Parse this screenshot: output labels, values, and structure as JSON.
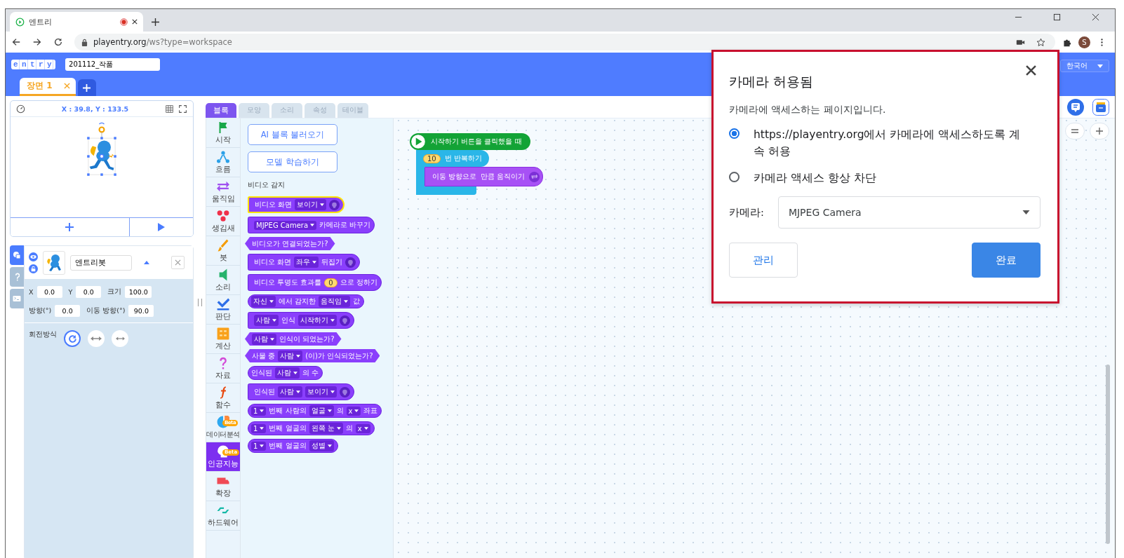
{
  "browser": {
    "tab": {
      "title": "엔트리",
      "recording": true
    },
    "url_host": "playentry.org",
    "url_path": "/ws?type=workspace",
    "profile_initial": "S"
  },
  "header": {
    "logo": "entry",
    "project_name": "201112_작품",
    "language": "한국어",
    "scenes": [
      {
        "label": "장면 1",
        "selected": true
      }
    ]
  },
  "stage": {
    "coordinates": "X : 39.8, Y : 133.5"
  },
  "object_panel": {
    "side_tabs": [
      {
        "selected": true
      },
      {
        "selected": false
      },
      {
        "selected": false
      }
    ],
    "name": "엔트리봇",
    "fields": [
      {
        "label": "X",
        "value": "0.0"
      },
      {
        "label": "Y",
        "value": "0.0"
      },
      {
        "label": "크기",
        "value": "100.0"
      },
      {
        "label": "방향(°)",
        "value": "0.0"
      },
      {
        "label": "이동 방향(°)",
        "value": "90.0"
      }
    ],
    "rotation_label": "회전방식",
    "rotation_modes": [
      {
        "selected": true
      },
      {
        "selected": false
      },
      {
        "selected": false
      }
    ]
  },
  "palette": {
    "tabs": [
      {
        "label": "블록",
        "selected": true
      },
      {
        "label": "모양",
        "selected": false
      },
      {
        "label": "소리",
        "selected": false
      },
      {
        "label": "속성",
        "selected": false
      },
      {
        "label": "테이블",
        "selected": false
      }
    ],
    "categories": [
      {
        "label": "시작",
        "selected": false
      },
      {
        "label": "흐름",
        "selected": false
      },
      {
        "label": "움직임",
        "selected": false
      },
      {
        "label": "생김새",
        "selected": false
      },
      {
        "label": "붓",
        "selected": false
      },
      {
        "label": "소리",
        "selected": false
      },
      {
        "label": "판단",
        "selected": false
      },
      {
        "label": "계산",
        "selected": false
      },
      {
        "label": "자료",
        "selected": false
      },
      {
        "label": "함수",
        "selected": false
      },
      {
        "label": "데이터분석",
        "badge": "Beta",
        "selected": false
      },
      {
        "label": "인공지능",
        "badge": "Beta",
        "selected": true
      },
      {
        "label": "확장",
        "selected": false
      },
      {
        "label": "하드웨어",
        "selected": false
      }
    ],
    "buttons": [
      "AI 블록 불러오기",
      "모델 학습하기"
    ],
    "section": "비디오 감지",
    "blocks": [
      {
        "kind": "command",
        "highlighted": true,
        "parts": [
          {
            "kind": "text",
            "text": "비디오 화면"
          },
          {
            "kind": "dropdown",
            "text": "보이기"
          },
          {
            "kind": "icon"
          }
        ]
      },
      {
        "kind": "command",
        "highlighted": false,
        "parts": [
          {
            "kind": "dropdown",
            "text": "MJPEG Camera"
          },
          {
            "kind": "text",
            "text": "카메라로 바꾸기"
          }
        ]
      },
      {
        "kind": "boolean",
        "highlighted": false,
        "parts": [
          {
            "kind": "text",
            "text": "비디오가 연결되었는가?"
          }
        ]
      },
      {
        "kind": "command",
        "highlighted": false,
        "parts": [
          {
            "kind": "text",
            "text": "비디오 화면"
          },
          {
            "kind": "dropdown",
            "text": "좌우"
          },
          {
            "kind": "text",
            "text": "뒤집기"
          },
          {
            "kind": "icon"
          }
        ]
      },
      {
        "kind": "command",
        "highlighted": false,
        "parts": [
          {
            "kind": "text",
            "text": "비디오 투명도 효과를"
          },
          {
            "kind": "number",
            "text": "0"
          },
          {
            "kind": "text",
            "text": "으로 정하기"
          }
        ]
      },
      {
        "kind": "reporter",
        "highlighted": false,
        "parts": [
          {
            "kind": "dropdown",
            "text": "자신"
          },
          {
            "kind": "text",
            "text": "에서 감지한"
          },
          {
            "kind": "dropdown",
            "text": "움직임"
          },
          {
            "kind": "text",
            "text": "값"
          }
        ]
      },
      {
        "kind": "command",
        "highlighted": false,
        "parts": [
          {
            "kind": "dropdown",
            "text": "사람"
          },
          {
            "kind": "text",
            "text": "인식"
          },
          {
            "kind": "dropdown",
            "text": "시작하기"
          },
          {
            "kind": "icon"
          }
        ]
      },
      {
        "kind": "boolean",
        "highlighted": false,
        "parts": [
          {
            "kind": "dropdown",
            "text": "사람"
          },
          {
            "kind": "text",
            "text": "인식이 되었는가?"
          }
        ]
      },
      {
        "kind": "boolean",
        "highlighted": false,
        "parts": [
          {
            "kind": "text",
            "text": "사물 중"
          },
          {
            "kind": "dropdown",
            "text": "사람"
          },
          {
            "kind": "text",
            "text": "(이)가 인식되었는가?"
          }
        ]
      },
      {
        "kind": "reporter",
        "highlighted": false,
        "parts": [
          {
            "kind": "text",
            "text": "인식된"
          },
          {
            "kind": "dropdown",
            "text": "사람"
          },
          {
            "kind": "text",
            "text": "의 수"
          }
        ]
      },
      {
        "kind": "command",
        "highlighted": false,
        "parts": [
          {
            "kind": "text",
            "text": "인식된"
          },
          {
            "kind": "dropdown",
            "text": "사람"
          },
          {
            "kind": "dropdown",
            "text": "보이기"
          },
          {
            "kind": "icon"
          }
        ]
      },
      {
        "kind": "reporter",
        "highlighted": false,
        "parts": [
          {
            "kind": "dropdown",
            "text": "1"
          },
          {
            "kind": "text",
            "text": "번째 사람의"
          },
          {
            "kind": "dropdown",
            "text": "얼굴"
          },
          {
            "kind": "text",
            "text": "의"
          },
          {
            "kind": "dropdown",
            "text": "x"
          },
          {
            "kind": "text",
            "text": "좌표"
          }
        ]
      },
      {
        "kind": "reporter",
        "highlighted": false,
        "parts": [
          {
            "kind": "dropdown",
            "text": "1"
          },
          {
            "kind": "text",
            "text": "번째 얼굴의"
          },
          {
            "kind": "dropdown",
            "text": "왼쪽 눈"
          },
          {
            "kind": "text",
            "text": "의"
          },
          {
            "kind": "dropdown",
            "text": "x"
          }
        ]
      },
      {
        "kind": "reporter",
        "highlighted": false,
        "parts": [
          {
            "kind": "dropdown",
            "text": "1"
          },
          {
            "kind": "text",
            "text": "번째 얼굴의"
          },
          {
            "kind": "dropdown",
            "text": "성별"
          }
        ]
      }
    ]
  },
  "script": {
    "hat": "시작하기 버튼을 클릭했을 때",
    "repeat": {
      "count": "10",
      "label": "번 반복하기"
    },
    "inner": [
      "이동 방향으로",
      "만큼 움직이기"
    ]
  },
  "dialog": {
    "title": "카메라 허용됨",
    "message": "카메라에 액세스하는 페이지입니다.",
    "options": [
      {
        "label": "https://playentry.org에서 카메라에 액세스하도록 계속 허용",
        "selected": true
      },
      {
        "label": "카메라 액세스 항상 차단",
        "selected": false
      }
    ],
    "camera_label": "카메라:",
    "camera": "MJPEG Camera",
    "buttons": [
      {
        "label": "관리",
        "primary": false
      },
      {
        "label": "완료",
        "primary": true
      }
    ]
  }
}
